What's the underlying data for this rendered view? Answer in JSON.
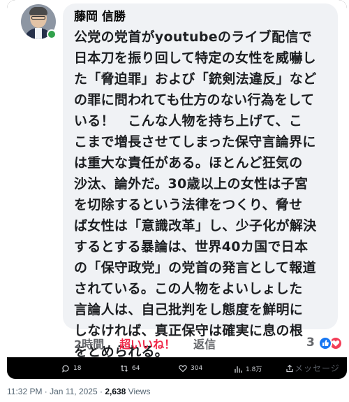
{
  "comment": {
    "author": "藤岡 信勝",
    "lines": [
      "公党の党首がyoutubeのライブ配信で",
      "日本刀を振り回して特定の女性を威嚇し",
      "た「脅迫罪」および「銃剣法違反」など",
      "の罪に問われても仕方のない行為をして",
      "いる！　こんな人物を持ち上げて、こ",
      "こまで増長させてしまった保守言論界に",
      "は重大な責任がある。ほとんど狂気の",
      "沙汰、論外だ。30歳以上の女性は子宮",
      "を切除するという法律をつくり、脅せ",
      "ば女性は「意識改革」し、少子化が解決",
      "するとする暴論は、世界40カ国で日本",
      "の「保守政党」の党首の発言として報道",
      "されている。この人物をよいしょした",
      "言論人は、自己批判をし態度を鮮明に",
      "しなければ、真正保守は確実に息の根",
      "をとめられる。"
    ],
    "time_ago": "2時間",
    "superlike_label": "超いいね！",
    "reply_label": "返信",
    "reaction_count": "3",
    "reaction_icons": [
      "like-icon",
      "love-icon"
    ]
  },
  "footer_stats": {
    "replies": "18",
    "reposts": "64",
    "likes": "304",
    "views": "1.8万",
    "ghost_message": "メッセージ"
  },
  "tweet_meta": {
    "timestamp": "11:32 PM · Jan 11, 2025 · ",
    "views_count": "2,638",
    "views_label": " Views"
  },
  "colors": {
    "accent_red": "#f02849",
    "like_blue": "#1877f2",
    "online_green": "#31a24c",
    "bubble_gray": "#f0f2f5"
  }
}
